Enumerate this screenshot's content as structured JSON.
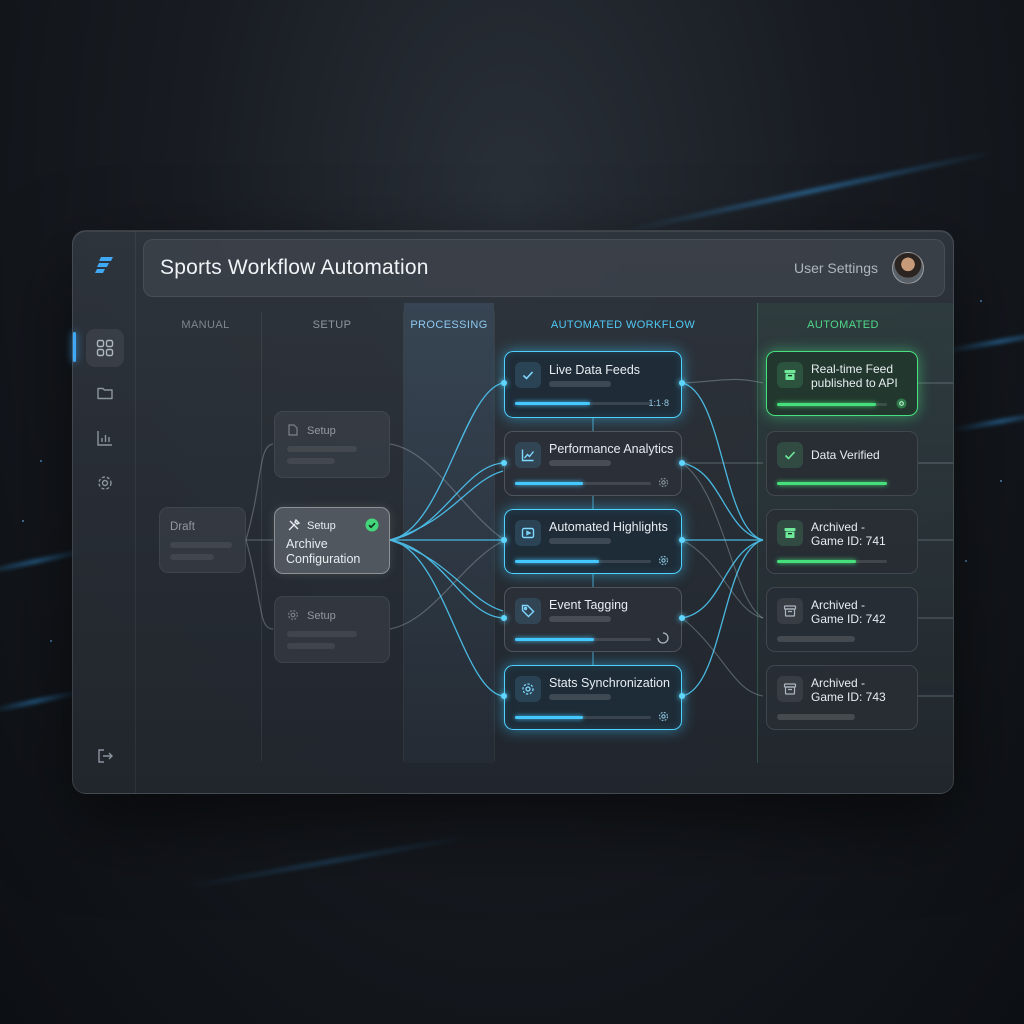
{
  "app": {
    "title": "Sports Workflow Automation",
    "user_settings_label": "User Settings"
  },
  "sidebar": {
    "logo": "bolt-logo-icon",
    "items": [
      {
        "icon": "grid-icon",
        "active": true
      },
      {
        "icon": "folder-icon",
        "active": false
      },
      {
        "icon": "bar-chart-icon",
        "active": false
      },
      {
        "icon": "gear-icon",
        "active": false
      }
    ],
    "logout_icon": "logout-icon"
  },
  "columns": [
    {
      "label": "MANUAL"
    },
    {
      "label": "SETUP"
    },
    {
      "label": "PROCESSING"
    },
    {
      "label": "AUTOMATED WORKFLOW"
    },
    {
      "label": "AUTOMATED"
    }
  ],
  "manual": {
    "draft": {
      "label": "Draft"
    }
  },
  "setup": {
    "top": {
      "label": "Setup",
      "icon": "document-icon"
    },
    "active": {
      "label": "Setup",
      "title": "Archive\nConfiguration",
      "icon": "tools-icon",
      "status_icon": "check-circle-icon"
    },
    "bottom": {
      "label": "Setup",
      "icon": "gear-icon"
    }
  },
  "workflow": [
    {
      "title": "Live Data Feeds",
      "icon": "check-icon",
      "progress": 0.55,
      "status": "1:1·8"
    },
    {
      "title": "Performance Analytics",
      "icon": "trend-chart-icon",
      "progress": 0.5,
      "status_icon": "gear-icon"
    },
    {
      "title": "Automated Highlights",
      "icon": "highlight-icon",
      "progress": 0.62,
      "status_icon": "gear-icon"
    },
    {
      "title": "Event Tagging",
      "icon": "tag-icon",
      "progress": 0.58,
      "status_icon": "spinner-icon"
    },
    {
      "title": "Stats Synchronization",
      "icon": "sync-gear-icon",
      "progress": 0.5,
      "status_icon": "gear-icon"
    }
  ],
  "automated": [
    {
      "title": "Real-time Feed\npublished to API",
      "icon": "archive-box-icon",
      "progress": 0.9,
      "highlight": true,
      "status_icon": "gear-icon"
    },
    {
      "title": "Data Verified",
      "icon": "check-icon",
      "progress": 1.0
    },
    {
      "title": "Archived -\nGame ID: 741",
      "icon": "archive-box-icon",
      "progress": 0.72
    },
    {
      "title": "Archived -\nGame ID: 742",
      "icon": "archive-box-icon",
      "progress": 0
    },
    {
      "title": "Archived -\nGame ID: 743",
      "icon": "archive-box-icon",
      "progress": 0
    }
  ],
  "colors": {
    "accent_blue": "#4fd0ff",
    "accent_green": "#49e07f",
    "background": "#181c22"
  }
}
